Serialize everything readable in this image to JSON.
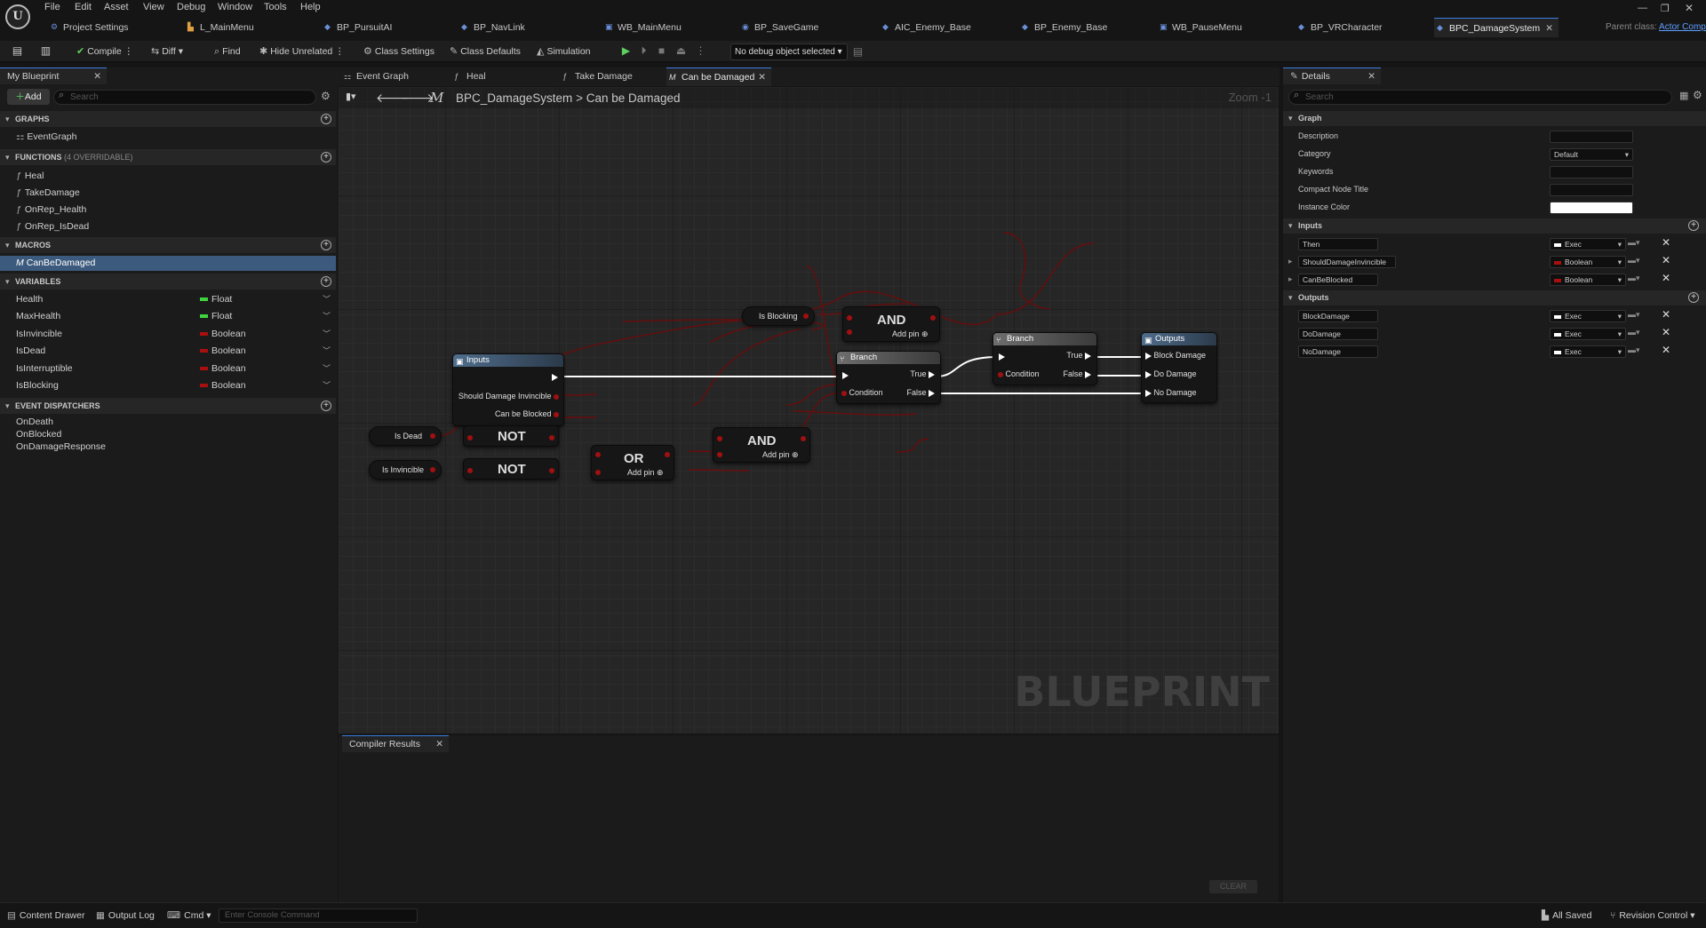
{
  "menu": [
    "File",
    "Edit",
    "Asset",
    "View",
    "Debug",
    "Window",
    "Tools",
    "Help"
  ],
  "doc_tabs": [
    {
      "label": "Project Settings",
      "icon": "gear-icon"
    },
    {
      "label": "L_MainMenu",
      "icon": "level-icon"
    },
    {
      "label": "BP_PursuitAI",
      "icon": "blueprint-icon"
    },
    {
      "label": "BP_NavLink",
      "icon": "blueprint-icon"
    },
    {
      "label": "WB_MainMenu",
      "icon": "widget-icon"
    },
    {
      "label": "BP_SaveGame",
      "icon": "blueprint-icon"
    },
    {
      "label": "AIC_Enemy_Base",
      "icon": "blueprint-icon"
    },
    {
      "label": "BP_Enemy_Base",
      "icon": "blueprint-icon"
    },
    {
      "label": "WB_PauseMenu",
      "icon": "widget-icon"
    },
    {
      "label": "BP_VRCharacter",
      "icon": "blueprint-icon"
    },
    {
      "label": "BPC_DamageSystem",
      "icon": "blueprint-icon"
    }
  ],
  "parent_class": {
    "label": "Parent class:",
    "value": "Actor Component"
  },
  "toolbar": {
    "compile": "Compile",
    "diff": "Diff",
    "find": "Find",
    "hide_unrelated": "Hide Unrelated",
    "class_settings": "Class Settings",
    "class_defaults": "Class Defaults",
    "simulation": "Simulation",
    "debug_select": "No debug object selected"
  },
  "my_blueprint": {
    "tab": "My Blueprint",
    "add": "Add",
    "search_placeholder": "Search",
    "graphs_title": "GRAPHS",
    "graphs": [
      "EventGraph"
    ],
    "functions_title": "FUNCTIONS",
    "functions_note": "(4 OVERRIDABLE)",
    "functions": [
      "Heal",
      "TakeDamage",
      "OnRep_Health",
      "OnRep_IsDead"
    ],
    "macros_title": "MACROS",
    "macros": [
      "CanBeDamaged"
    ],
    "variables_title": "VARIABLES",
    "variables": [
      {
        "name": "Health",
        "type": "Float",
        "color": "#3fd43f"
      },
      {
        "name": "MaxHealth",
        "type": "Float",
        "color": "#3fd43f"
      },
      {
        "name": "IsInvincible",
        "type": "Boolean",
        "color": "#a81010"
      },
      {
        "name": "IsDead",
        "type": "Boolean",
        "color": "#a81010"
      },
      {
        "name": "IsInterruptible",
        "type": "Boolean",
        "color": "#a81010"
      },
      {
        "name": "IsBlocking",
        "type": "Boolean",
        "color": "#a81010"
      }
    ],
    "dispatchers_title": "EVENT DISPATCHERS",
    "dispatchers": [
      "OnDeath",
      "OnBlocked",
      "OnDamageResponse"
    ]
  },
  "graph_tabs": [
    {
      "label": "Event Graph"
    },
    {
      "label": "Heal"
    },
    {
      "label": "Take Damage"
    },
    {
      "label": "Can be Damaged"
    }
  ],
  "breadcrumb": {
    "root": "BPC_DamageSystem",
    "sep": ">",
    "current": "Can be Damaged"
  },
  "zoom": "Zoom -1",
  "watermark": "BLUEPRINT",
  "nodes": {
    "inputs": {
      "title": "Inputs",
      "pin1": "Should Damage Invincible",
      "pin2": "Can be Blocked"
    },
    "is_dead": "Is Dead",
    "is_invincible": "Is Invincible",
    "is_blocking": "Is Blocking",
    "not": "NOT",
    "or": "OR",
    "and": "AND",
    "add_pin": "Add pin",
    "branch": {
      "title": "Branch",
      "cond": "Condition",
      "t": "True",
      "f": "False"
    },
    "outputs": {
      "title": "Outputs",
      "p1": "Block Damage",
      "p2": "Do Damage",
      "p3": "No Damage"
    }
  },
  "compiler": {
    "tab": "Compiler Results",
    "clear": "CLEAR"
  },
  "details": {
    "tab": "Details",
    "search_placeholder": "Search",
    "graph_title": "Graph",
    "graph_rows": [
      {
        "label": "Description",
        "value": ""
      },
      {
        "label": "Category",
        "value": "Default"
      },
      {
        "label": "Keywords",
        "value": ""
      },
      {
        "label": "Compact Node Title",
        "value": ""
      },
      {
        "label": "Instance Color",
        "value": ""
      }
    ],
    "inputs_title": "Inputs",
    "inputs": [
      {
        "name": "Then",
        "type": "Exec",
        "color": "#ffffff"
      },
      {
        "name": "ShouldDamageInvincible",
        "type": "Boolean",
        "color": "#a81010"
      },
      {
        "name": "CanBeBlocked",
        "type": "Boolean",
        "color": "#a81010"
      }
    ],
    "outputs_title": "Outputs",
    "outputs": [
      {
        "name": "BlockDamage",
        "type": "Exec",
        "color": "#ffffff"
      },
      {
        "name": "DoDamage",
        "type": "Exec",
        "color": "#ffffff"
      },
      {
        "name": "NoDamage",
        "type": "Exec",
        "color": "#ffffff"
      }
    ]
  },
  "status": {
    "content_drawer": "Content Drawer",
    "output_log": "Output Log",
    "cmd": "Cmd",
    "console_placeholder": "Enter Console Command",
    "all_saved": "All Saved",
    "revision": "Revision Control"
  }
}
